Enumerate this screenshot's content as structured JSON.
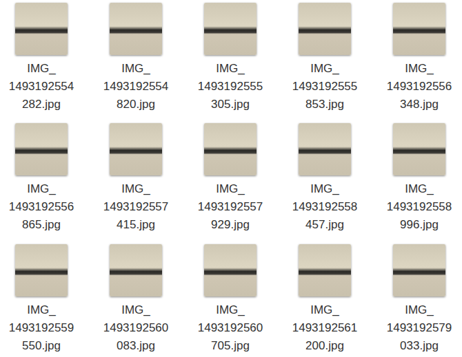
{
  "files": [
    {
      "lines": [
        "IMG_",
        "1493192554",
        "282.jpg"
      ]
    },
    {
      "lines": [
        "IMG_",
        "1493192554",
        "820.jpg"
      ]
    },
    {
      "lines": [
        "IMG_",
        "1493192555",
        "305.jpg"
      ]
    },
    {
      "lines": [
        "IMG_",
        "1493192555",
        "853.jpg"
      ]
    },
    {
      "lines": [
        "IMG_",
        "1493192556",
        "348.jpg"
      ]
    },
    {
      "lines": [
        "IMG_",
        "1493192556",
        "865.jpg"
      ]
    },
    {
      "lines": [
        "IMG_",
        "1493192557",
        "415.jpg"
      ]
    },
    {
      "lines": [
        "IMG_",
        "1493192557",
        "929.jpg"
      ]
    },
    {
      "lines": [
        "IMG_",
        "1493192558",
        "457.jpg"
      ]
    },
    {
      "lines": [
        "IMG_",
        "1493192558",
        "996.jpg"
      ]
    },
    {
      "lines": [
        "IMG_",
        "1493192559",
        "550.jpg"
      ]
    },
    {
      "lines": [
        "IMG_",
        "1493192560",
        "083.jpg"
      ]
    },
    {
      "lines": [
        "IMG_",
        "1493192560",
        "705.jpg"
      ]
    },
    {
      "lines": [
        "IMG_",
        "1493192561",
        "200.jpg"
      ]
    },
    {
      "lines": [
        "IMG_",
        "1493192579",
        "033.jpg"
      ]
    }
  ]
}
